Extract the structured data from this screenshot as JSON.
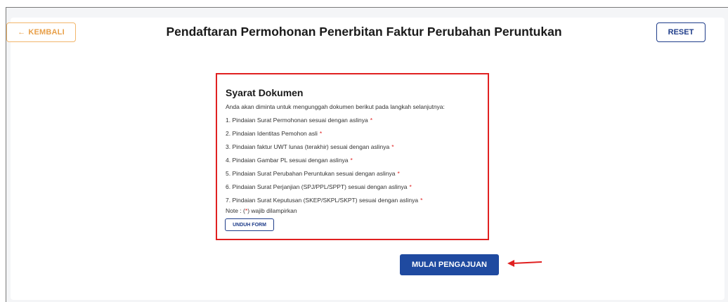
{
  "header": {
    "back_arrow": "←",
    "back_label": "KEMBALI",
    "title": "Pendaftaran Permohonan Penerbitan Faktur Perubahan Peruntukan",
    "reset_label": "RESET"
  },
  "requirements": {
    "title": "Syarat Dokumen",
    "intro": "Anda akan diminta untuk mengunggah dokumen berikut pada langkah selanjutnya:",
    "items": [
      "1. Pindaian Surat Permohonan sesuai dengan aslinya",
      "2. Pindaian Identitas Pemohon asli",
      "3. Pindaian faktur UWT lunas (terakhir) sesuai dengan aslinya",
      "4. Pindaian Gambar PL sesuai dengan aslinya",
      "5. Pindaian Surat Perubahan Peruntukan sesuai dengan aslinya",
      "6. Pindaian Surat Perjanjian (SPJ/PPL/SPPT) sesuai dengan aslinya",
      "7. Pindaian Surat Keputusan (SKEP/SKPL/SKPT) sesuai dengan aslinya"
    ],
    "required_mark": "*",
    "note_prefix": "Note : (",
    "note_suffix": ") wajib dilampirkan",
    "download_label": "UNDUH FORM"
  },
  "actions": {
    "start_label": "MULAI PENGAJUAN"
  },
  "colors": {
    "primary": "#1f4aa0",
    "accent": "#e8a04a",
    "highlight": "#e02020"
  }
}
